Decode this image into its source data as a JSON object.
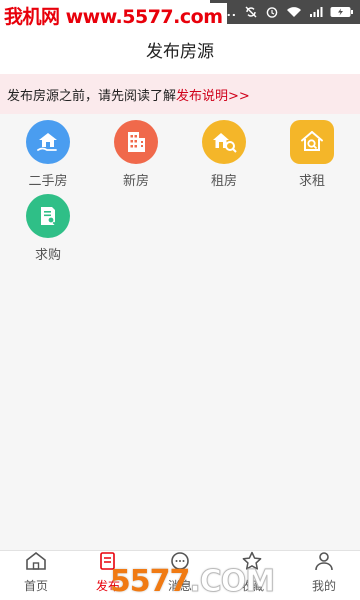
{
  "watermark": {
    "top": "我机网 www.5577.com",
    "bottom_a": "5577",
    "bottom_b": ".COM"
  },
  "status_bar": {
    "dots": "...",
    "icons": [
      "sync-off-icon",
      "alarm-icon",
      "wifi-icon",
      "signal-icon",
      "battery-charging-icon"
    ]
  },
  "header": {
    "title": "发布房源"
  },
  "notice": {
    "text": "发布房源之前，请先阅读了解",
    "link": "发布说明>>"
  },
  "categories": [
    {
      "label": "二手房",
      "color": "#4a9df0",
      "icon": "house-hand-icon"
    },
    {
      "label": "新房",
      "color": "#f0694b",
      "icon": "building-icon"
    },
    {
      "label": "租房",
      "color": "#f4b629",
      "icon": "house-key-icon"
    },
    {
      "label": "求租",
      "color": "#f4b629",
      "icon": "house-search-icon"
    },
    {
      "label": "求购",
      "color": "#2fbf87",
      "icon": "document-search-icon"
    }
  ],
  "bottom_nav": [
    {
      "label": "首页",
      "icon": "home-icon"
    },
    {
      "label": "发布",
      "icon": "publish-icon",
      "active": true
    },
    {
      "label": "消息",
      "icon": "message-icon"
    },
    {
      "label": "收藏",
      "icon": "star-icon"
    },
    {
      "label": "我的",
      "icon": "user-icon"
    }
  ],
  "colors": {
    "accent": "#e8000b",
    "notice_bg": "#fbeaec"
  }
}
